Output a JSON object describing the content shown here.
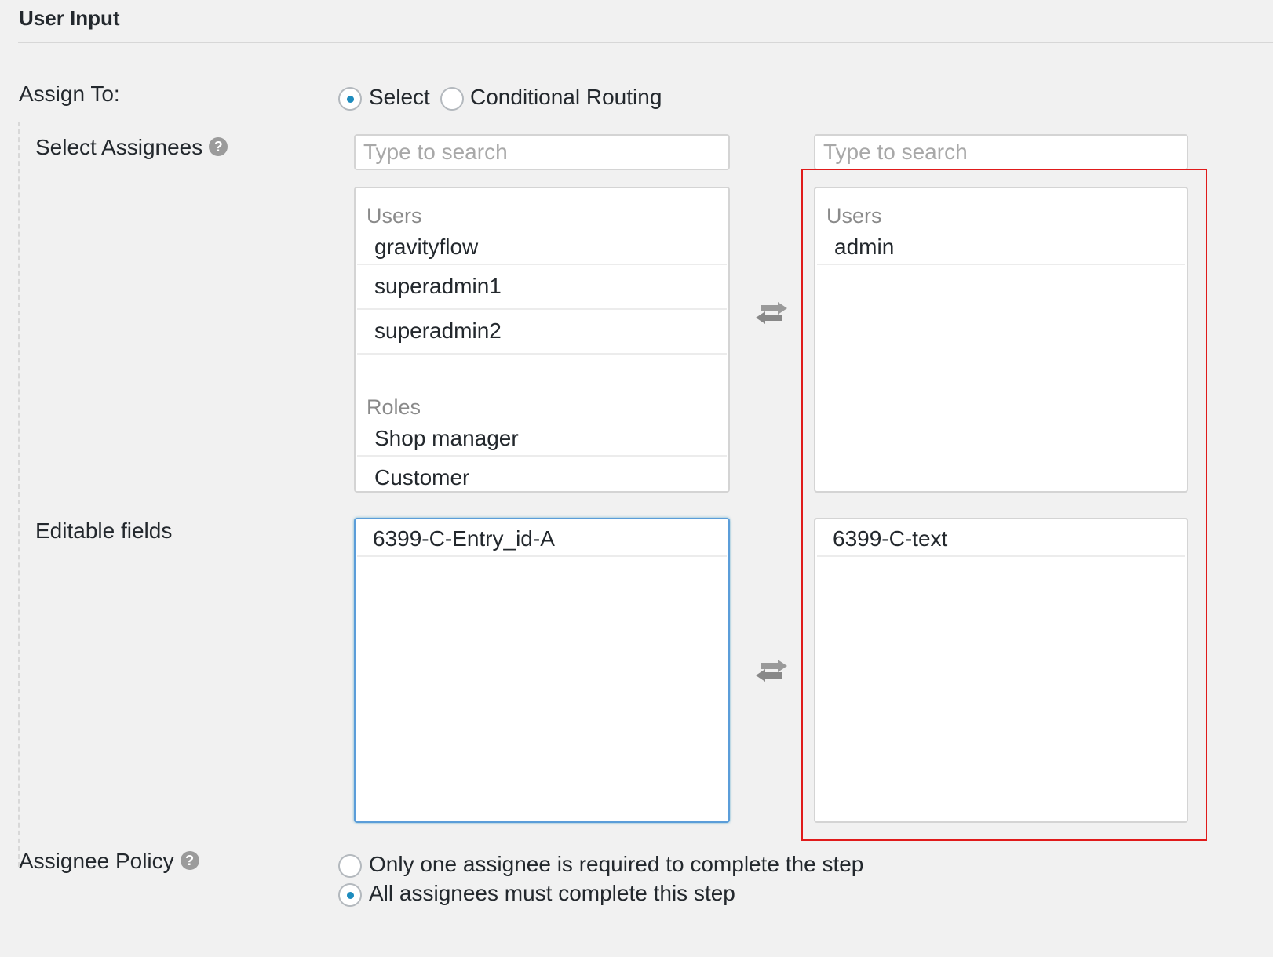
{
  "section": {
    "title": "User Input"
  },
  "assign_to": {
    "label": "Assign To:",
    "options": [
      {
        "label": "Select",
        "checked": true
      },
      {
        "label": "Conditional Routing",
        "checked": false
      }
    ]
  },
  "select_assignees": {
    "label": "Select Assignees",
    "help_icon": "question-circle-icon",
    "available": {
      "search_placeholder": "Type to search",
      "groups": [
        {
          "name": "Users",
          "items": [
            "gravityflow",
            "superadmin1",
            "superadmin2"
          ]
        },
        {
          "name": "Roles",
          "items": [
            "Shop manager",
            "Customer"
          ]
        }
      ]
    },
    "swap_icon": "swap-arrows-icon",
    "selected": {
      "search_placeholder": "Type to search",
      "groups": [
        {
          "name": "Users",
          "items": [
            "admin"
          ]
        }
      ]
    }
  },
  "editable_fields": {
    "label": "Editable fields",
    "available": [
      "6399-C-Entry_id-A"
    ],
    "swap_icon": "swap-arrows-icon",
    "selected": [
      "6399-C-text"
    ]
  },
  "assignee_policy": {
    "label": "Assignee Policy",
    "help_icon": "question-circle-icon",
    "options": [
      {
        "label": "Only one assignee is required to complete the step",
        "checked": false
      },
      {
        "label": "All assignees must complete this step",
        "checked": true
      }
    ]
  },
  "colors": {
    "accent": "#1e8cbe",
    "highlight": "#e01b1b",
    "focus": "#5b9dd9"
  }
}
